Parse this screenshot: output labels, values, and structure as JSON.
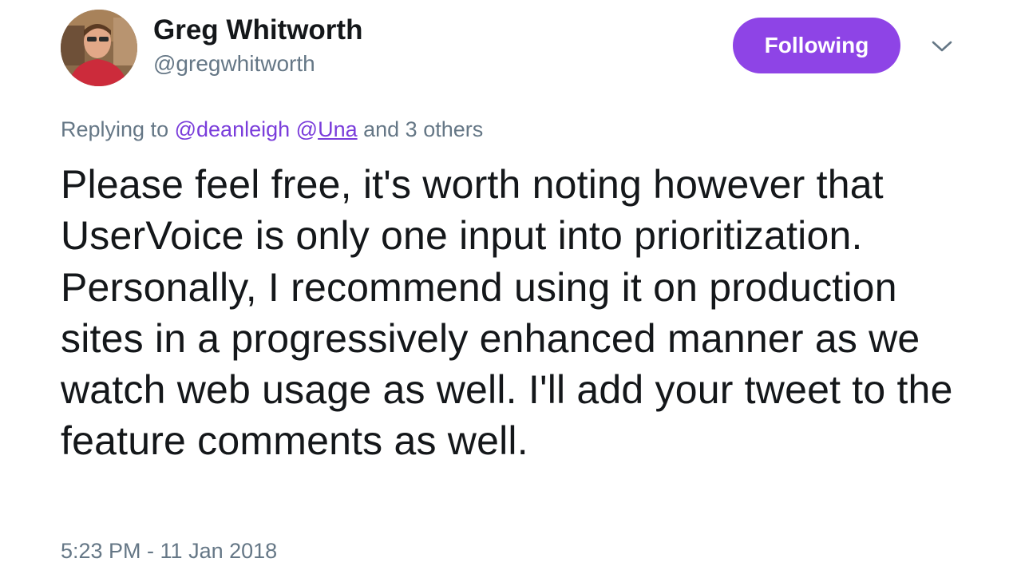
{
  "user": {
    "display_name": "Greg Whitworth",
    "handle": "@gregwhitworth",
    "follow_button_label": "Following"
  },
  "reply": {
    "prefix": "Replying to",
    "mention_1": "@deanleigh",
    "mention_2_at": "@",
    "mention_2_name": "Una",
    "suffix": "and 3 others"
  },
  "tweet": {
    "text": "Please feel free, it's worth noting however that UserVoice is only one input into prioritization. Personally, I recommend using it on production sites in a progressively enhanced manner as we watch web usage as well. I'll add your tweet to the feature comments as well.",
    "timestamp": "5:23 PM - 11 Jan 2018"
  },
  "icons": {
    "avatar": "profile-photo",
    "menu": "chevron-down-icon"
  },
  "colors": {
    "accent": "#8e44e6",
    "mention": "#7a3ddb",
    "secondary_text": "#657786",
    "primary_text": "#14171a"
  }
}
